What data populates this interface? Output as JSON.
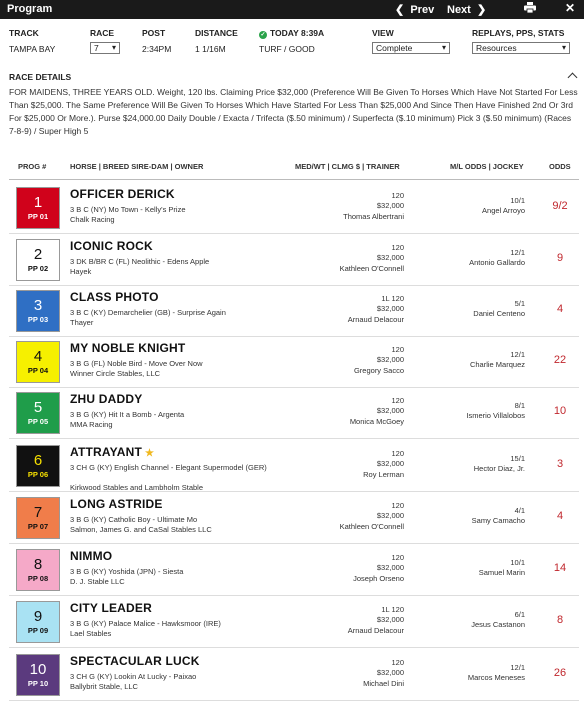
{
  "topbar": {
    "title": "Program",
    "prev_label": "Prev",
    "next_label": "Next",
    "prev_arrow": "❮",
    "next_arrow": "❯",
    "print_icon": "print-icon",
    "close_icon": "close-icon",
    "bg_color": "#1a1a1a"
  },
  "header": {
    "track_label": "TRACK",
    "track_value": "TAMPA BAY",
    "race_label": "RACE",
    "race_value": "7",
    "post_label": "POST",
    "post_value": "2:34PM",
    "distance_label": "DISTANCE",
    "distance_value": "1 1/16M",
    "today_label": "TODAY 8:39A",
    "surface_value": "TURF / GOOD",
    "view_label": "VIEW",
    "view_value": "Complete",
    "replays_label": "REPLAYS, PPS, STATS",
    "replays_value": "Resources"
  },
  "race_details": {
    "title": "RACE DETAILS",
    "text": "FOR MAIDENS, THREE YEARS OLD. Weight, 120 lbs. Claiming Price $32,000 (Preference Will Be Given To Horses Which Have Not Started For Less Than $25,000. The Same Preference Will Be Given To Horses Which Have Started For Less Than $25,000 And Since Then Have Finished 2nd Or 3rd For $25,000 Or More.). Purse $24,000.00 Daily Double / Exacta / Trifecta ($.50 minimum) / Superfecta ($.10 minimum) Pick 3 ($.50 minimum) (Races 7-8-9) / Super High 5"
  },
  "columns": {
    "prog": "PROG #",
    "horse": "HORSE | BREED SIRE-DAM | OWNER",
    "med": "MED/WT | CLMG $ | TRAINER",
    "ml": "M/L ODDS | JOCKEY",
    "odds": "ODDS"
  },
  "entries": [
    {
      "num": "1",
      "pp": "PP 01",
      "name": "OFFICER DERICK",
      "star": "",
      "breed": "3 B C (NY) Mo Town - Kelly's Prize",
      "owner": "Chalk Racing",
      "med": "",
      "wt": "120",
      "clmg": "$32,000",
      "trainer": "Thomas Albertrani",
      "ml": "10/1",
      "jockey": "Angel Arroyo",
      "odds": "9/2",
      "bg": "#d0021b",
      "fg": "#ffffff"
    },
    {
      "num": "2",
      "pp": "PP 02",
      "name": "ICONIC ROCK",
      "star": "",
      "breed": "3 DK B/BR C (FL) Neolithic - Edens Apple",
      "owner": "Hayek",
      "med": "",
      "wt": "120",
      "clmg": "$32,000",
      "trainer": "Kathleen O'Connell",
      "ml": "12/1",
      "jockey": "Antonio Gallardo",
      "odds": "9",
      "bg": "#ffffff",
      "fg": "#111111"
    },
    {
      "num": "3",
      "pp": "PP 03",
      "name": "CLASS PHOTO",
      "star": "",
      "breed": "3 B C (KY) Demarchelier (GB) - Surprise Again",
      "owner": "Thayer",
      "med": "1L",
      "wt": "120",
      "clmg": "$32,000",
      "trainer": "Arnaud Delacour",
      "ml": "5/1",
      "jockey": "Daniel Centeno",
      "odds": "4",
      "bg": "#2f6fc4",
      "fg": "#ffffff"
    },
    {
      "num": "4",
      "pp": "PP 04",
      "name": "MY NOBLE KNIGHT",
      "star": "",
      "breed": "3 B G (FL) Noble Bird - Move Over Now",
      "owner": "Winner Circle Stables, LLC",
      "med": "",
      "wt": "120",
      "clmg": "$32,000",
      "trainer": "Gregory Sacco",
      "ml": "12/1",
      "jockey": "Charlie Marquez",
      "odds": "22",
      "bg": "#f6f000",
      "fg": "#111111"
    },
    {
      "num": "5",
      "pp": "PP 05",
      "name": "ZHU DADDY",
      "star": "",
      "breed": "3 B G (KY) Hit It a Bomb - Argenta",
      "owner": "MMA Racing",
      "med": "",
      "wt": "120",
      "clmg": "$32,000",
      "trainer": "Monica McGoey",
      "ml": "8/1",
      "jockey": "Ismerio Villalobos",
      "odds": "10",
      "bg": "#1f9d4a",
      "fg": "#ffffff"
    },
    {
      "num": "6",
      "pp": "PP 06",
      "name": "ATTRAYANT",
      "star": "★",
      "breed": "3 CH G (KY) English Channel - Elegant Supermodel (GER)",
      "owner": "Kirkwood Stables and Lambholm Stable",
      "med": "",
      "wt": "120",
      "clmg": "$32,000",
      "trainer": "Roy Lerman",
      "ml": "15/1",
      "jockey": "Hector Diaz, Jr.",
      "odds": "3",
      "bg": "#111111",
      "fg": "#f6e000"
    },
    {
      "num": "7",
      "pp": "PP 07",
      "name": "LONG ASTRIDE",
      "star": "",
      "breed": "3 B G (KY) Catholic Boy - Ultimate Mo",
      "owner": "Salmon, James G. and CaSal Stables LLC",
      "med": "",
      "wt": "120",
      "clmg": "$32,000",
      "trainer": "Kathleen O'Connell",
      "ml": "4/1",
      "jockey": "Samy Camacho",
      "odds": "4",
      "bg": "#f07d4a",
      "fg": "#111111"
    },
    {
      "num": "8",
      "pp": "PP 08",
      "name": "NIMMO",
      "star": "",
      "breed": "3 B G (KY) Yoshida (JPN) - Siesta",
      "owner": "D. J. Stable LLC",
      "med": "",
      "wt": "120",
      "clmg": "$32,000",
      "trainer": "Joseph Orseno",
      "ml": "10/1",
      "jockey": "Samuel Marin",
      "odds": "14",
      "bg": "#f5a9c8",
      "fg": "#111111"
    },
    {
      "num": "9",
      "pp": "PP 09",
      "name": "CITY LEADER",
      "star": "",
      "breed": "3 B G (KY) Palace Malice - Hawksmoor (IRE)",
      "owner": "Lael Stables",
      "med": "1L",
      "wt": "120",
      "clmg": "$32,000",
      "trainer": "Arnaud Delacour",
      "ml": "6/1",
      "jockey": "Jesus Castanon",
      "odds": "8",
      "bg": "#a9e2f3",
      "fg": "#111111"
    },
    {
      "num": "10",
      "pp": "PP 10",
      "name": "SPECTACULAR LUCK",
      "star": "",
      "breed": "3 CH G (KY) Lookin At Lucky - Paixao",
      "owner": "Ballybrit Stable, LLC",
      "med": "",
      "wt": "120",
      "clmg": "$32,000",
      "trainer": "Michael Dini",
      "ml": "12/1",
      "jockey": "Marcos Meneses",
      "odds": "26",
      "bg": "#5b3a7e",
      "fg": "#ffffff"
    }
  ]
}
